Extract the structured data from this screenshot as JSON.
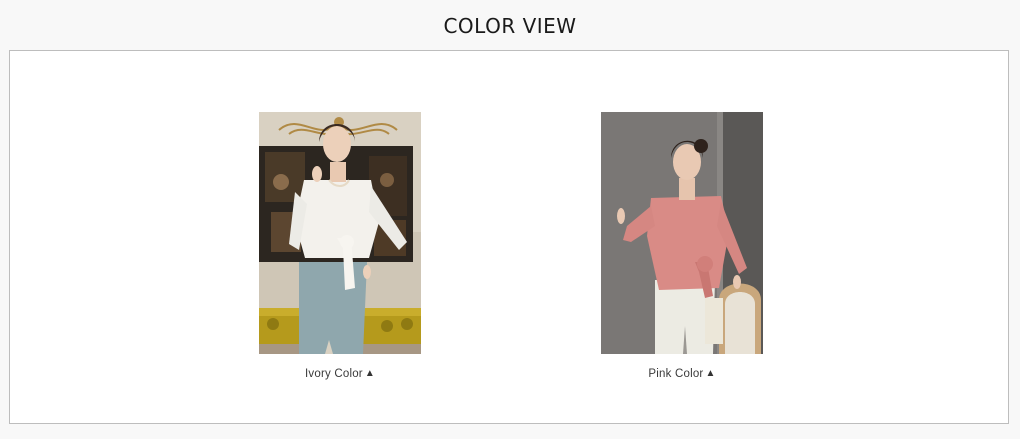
{
  "header": {
    "title": "COLOR VIEW"
  },
  "colors": [
    {
      "name": "Ivory",
      "suffix": "Color",
      "arrow": "▲",
      "swatch": "#f2f0ea"
    },
    {
      "name": "Pink",
      "suffix": "Color",
      "arrow": "▲",
      "swatch": "#d98b86"
    }
  ],
  "icons": {
    "arrow": "triangle-up-icon"
  }
}
